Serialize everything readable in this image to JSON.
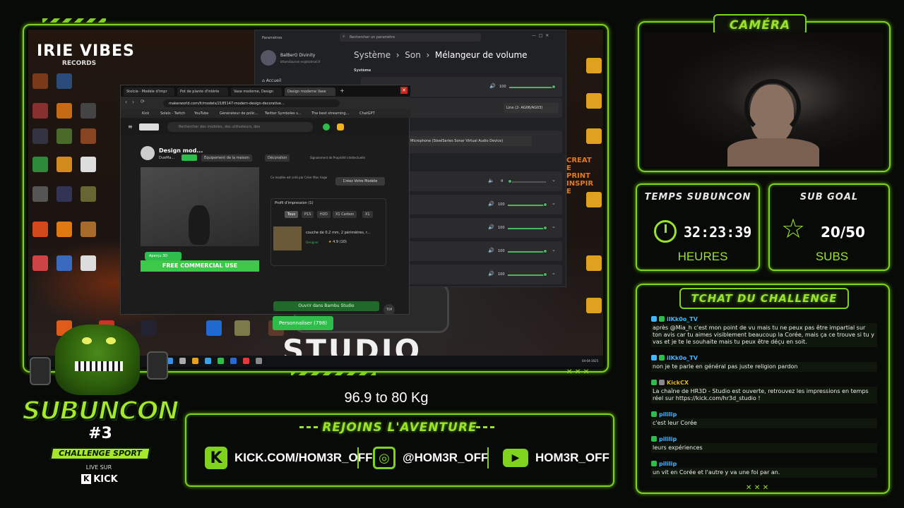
{
  "camera": {
    "title": "CAMÉRA"
  },
  "timer": {
    "title": "TEMPS SUBUNCON",
    "value": "32:23:39",
    "unit": "HEURES"
  },
  "subgoal": {
    "title": "SUB GOAL",
    "value": "20/50",
    "unit": "SUBS"
  },
  "chat": {
    "title": "TCHAT DU CHALLENGE",
    "messages": [
      {
        "user": "iIKk0o_TV",
        "user_color": "#3fb8ff",
        "text": "après @Mia_h c'est mon point de vu mais tu ne peux pas être impartial sur ton avis car tu aimes visiblement beaucoup la Corée, mais ça ce trouve si tu y vas et je te le souhaite mais tu peux être déçu en soit."
      },
      {
        "user": "iIKk0o_TV",
        "user_color": "#3fb8ff",
        "text": "non je te parle en général pas juste religion pardon"
      },
      {
        "user": "KickCX",
        "user_color": "#e2b714",
        "text": "La chaîne de HR3D - Studio est ouverte, retrouvez les impressions en temps réel sur https://kick.com/hr3d_studio !"
      },
      {
        "user": "pililip",
        "user_color": "#3fb8ff",
        "text": "c'est leur Corée"
      },
      {
        "user": "pililip",
        "user_color": "#3fb8ff",
        "text": "leurs expériences"
      },
      {
        "user": "pililip",
        "user_color": "#3fb8ff",
        "text": "un vit en Corée et l'autre y va une foi par an."
      }
    ]
  },
  "weight": "96.9 to 80 Kg",
  "banner": {
    "title": "REJOINS L'AVENTURE",
    "kick": "KICK.COM/HOM3R_OFF",
    "instagram": "@HOM3R_OFF",
    "youtube": "HOM3R_OFF"
  },
  "logo": {
    "line1": "SUBUNCON",
    "line2": "#3",
    "line3": "CHALLENGE SPORT",
    "line4": "LIVE SUR",
    "line5": "KICK"
  },
  "settings": {
    "search_placeholder": "Rechercher un paramètre",
    "user_name": "BalBerO Divinity",
    "user_email": "bttamdaurnel en@hotmail.fr",
    "nav_home": "Accueil",
    "breadcrumb": [
      "Système",
      "Son",
      "Mélangeur de volume"
    ],
    "section": "Système",
    "master_volume": "100",
    "output_device": "Line (2- AG06/AG03)",
    "input_device": "Microphone (SteelSeries Sonar Virtual Audio Device)",
    "app_volumes": [
      "4",
      "100",
      "100",
      "100",
      "100"
    ]
  },
  "browser": {
    "tabs": [
      "Stoïcie - Modèle d'impr",
      "Pot de plante d'intérie",
      "Vase moderne, Design",
      "Design moderne Vase"
    ],
    "url": "makerworld.com/fr/models/2185147-modern-design-decorative...",
    "bookmarks": [
      "Kick",
      "Soleis - Twitch",
      "YouTube",
      "Générateur de polic...",
      "Twitter Symboles s...",
      "The best streaming...",
      "ChatGPT"
    ],
    "search_placeholder": "Rechercher des modèles, des utilisateurs, des",
    "model_title": "Design mod...",
    "author": "DueMa...",
    "chip_tag": "Équipement de la maison",
    "chip_deco": "Décoration",
    "report": "Signalement de Propriété intellectuelle",
    "preview_btn": "Aperçu 3D",
    "commercial": "FREE COMMERCIAL USE",
    "created_by": "Ce modèle est créé par Créer Mon Ange",
    "create_model": "Créez Votre Modèle",
    "profile_title": "Profil d'impression (1)",
    "profile_tabs": [
      "Tous",
      "P1S",
      "H2D",
      "X1 Carbon",
      "X1"
    ],
    "profile_desc": "couche de 0.2 mm, 2 périmètres, r...",
    "designer_badge": "Designer",
    "rating": "4.9 (10)",
    "open_bambu": "Ouvrir dans Bambu Studio",
    "personalize": "Personnaliser (798)",
    "top": "TOP"
  },
  "desktop": {
    "brand_top": "IRIE VIBES",
    "brand_sub": "RECORDS",
    "studio_text": "STUDIO",
    "poster": "CREATE PRINT INSPIRE",
    "date": "04-04-2025",
    "time": "17:36"
  },
  "colors": {
    "neon": "#7fd31e",
    "bg": "#080a07",
    "accent_green": "#46b864"
  }
}
